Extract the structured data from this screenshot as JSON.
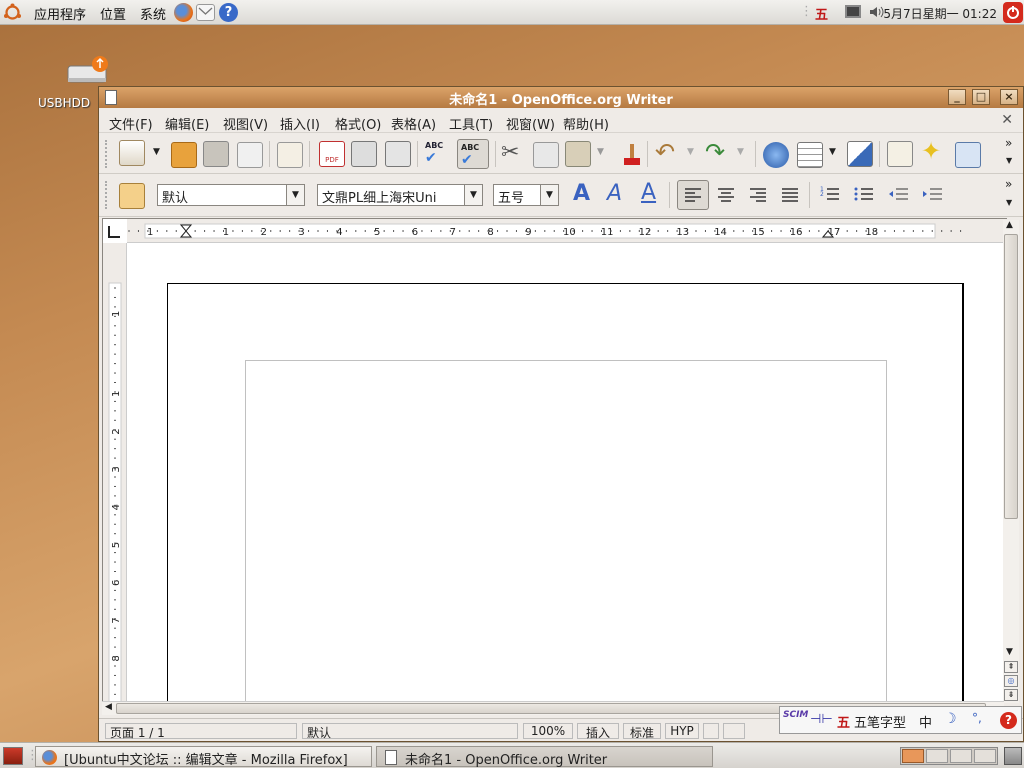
{
  "top_panel": {
    "applications": "应用程序",
    "places": "位置",
    "system": "系统",
    "ime_indicator": "五",
    "clock": "5月7日星期一 01:22"
  },
  "desktop": {
    "usb_label": "USBHDD"
  },
  "window": {
    "title": "未命名1 - OpenOffice.org Writer",
    "menu": [
      "文件(F)",
      "编辑(E)",
      "视图(V)",
      "插入(I)",
      "格式(O)",
      "表格(A)",
      "工具(T)",
      "视窗(W)",
      "帮助(H)"
    ],
    "style_value": "默认",
    "font_value": "文鼎PL细上海宋Uni",
    "size_value": "五号",
    "ruler_h": [
      "1",
      "1",
      "2",
      "3",
      "4",
      "5",
      "6",
      "7",
      "8",
      "9",
      "10",
      "11",
      "12",
      "13",
      "14",
      "15",
      "16",
      "17",
      "18"
    ],
    "ruler_v": [
      "1",
      "1",
      "2",
      "3",
      "4",
      "5",
      "6",
      "7",
      "8"
    ],
    "status": {
      "page": "页面 1 / 1",
      "style": "默认",
      "zoom": "100%",
      "insert": "插入",
      "std": "标准",
      "hyp": "HYP"
    }
  },
  "ime_bar": {
    "logo": "SCIM",
    "mode_char": "五",
    "mode_label": "五笔字型",
    "cn": "中"
  },
  "taskbar": {
    "firefox_task": "[Ubuntu中文论坛 :: 编辑文章 - Mozilla Firefox]",
    "writer_task": "未命名1 - OpenOffice.org Writer"
  },
  "colors": {
    "accent": "#c07a3c",
    "title_bar": "#c48a52",
    "shutdown": "#cc2a1a"
  }
}
